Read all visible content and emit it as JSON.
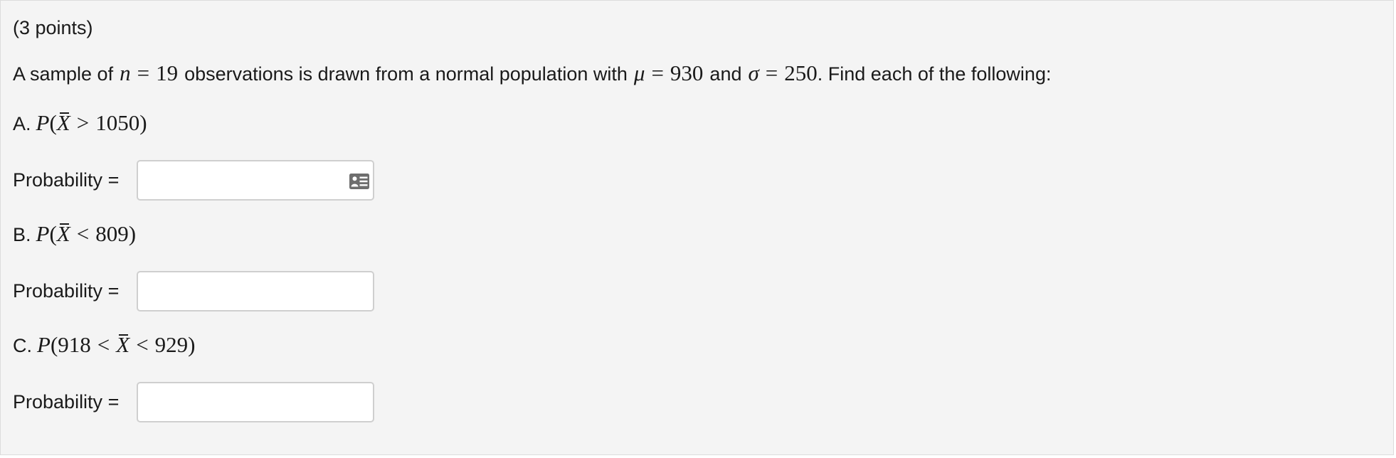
{
  "question": {
    "points": "(3 points)",
    "intro": {
      "t1": "A sample of",
      "n_var": "n",
      "eq1": "=",
      "n_val": "19",
      "t2": "observations is drawn from a normal population with",
      "mu_var": "μ",
      "eq2": "=",
      "mu_val": "930",
      "t3": "and",
      "sigma_var": "σ",
      "eq3": "=",
      "sigma_val": "250",
      "t4": ". Find each of the following:"
    },
    "parts": [
      {
        "letter": "A.",
        "p": "P",
        "open": "(",
        "xbar": "X",
        "op": ">",
        "value": "1050",
        "close": ")",
        "answer_label": "Probability =",
        "answer_value": "",
        "preview_icon": "answer-preview-icon"
      },
      {
        "letter": "B.",
        "p": "P",
        "open": "(",
        "xbar": "X",
        "op": "<",
        "value": "809",
        "close": ")",
        "answer_label": "Probability =",
        "answer_value": ""
      },
      {
        "letter": "C.",
        "p": "P",
        "open": "(",
        "low": "918",
        "op1": "<",
        "xbar": "X",
        "op2": "<",
        "high": "929",
        "close": ")",
        "answer_label": "Probability =",
        "answer_value": ""
      }
    ]
  }
}
